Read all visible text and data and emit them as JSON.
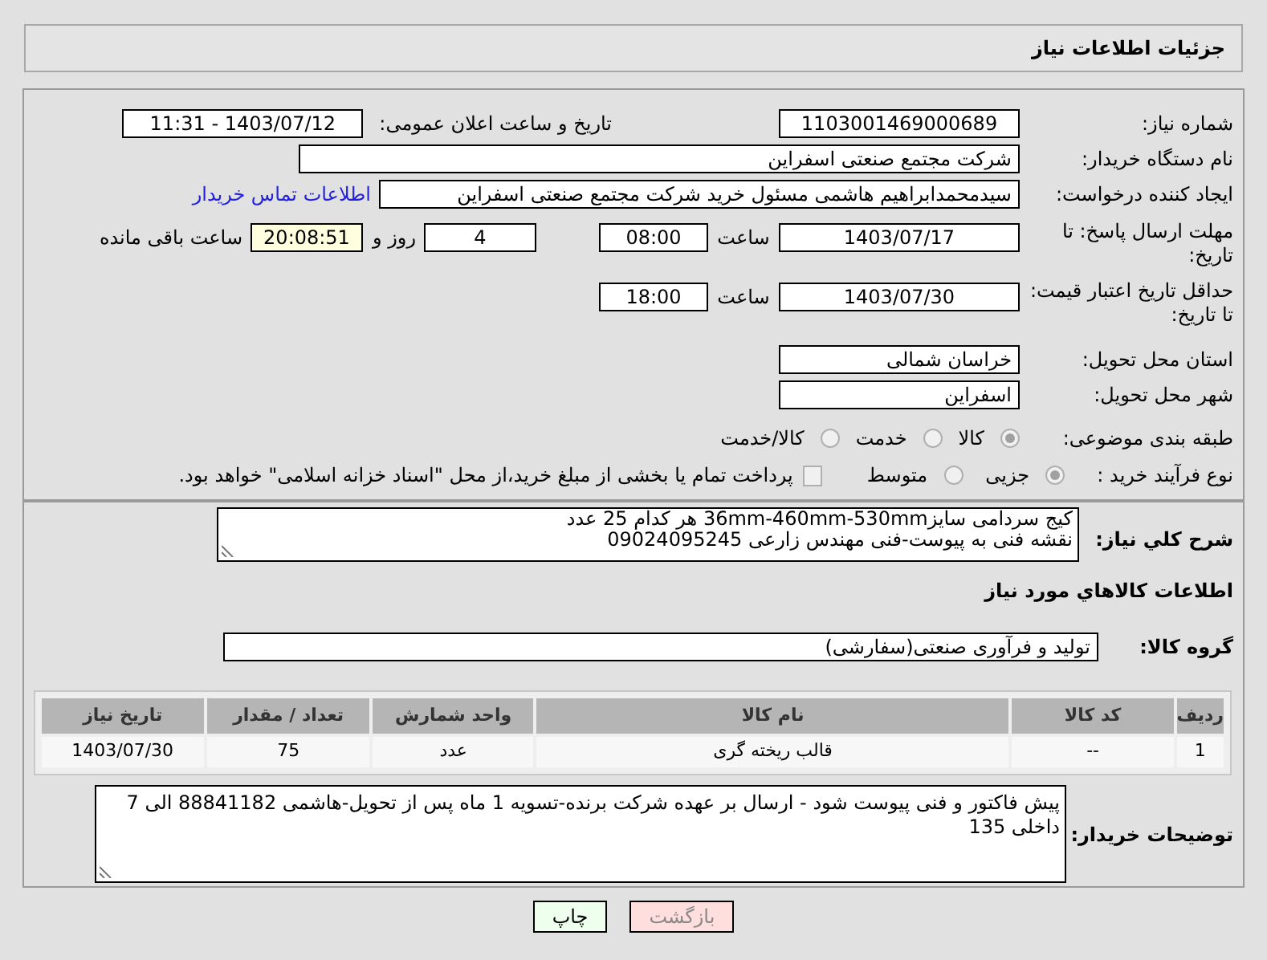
{
  "window": {
    "title": "جزئیات اطلاعات نیاز"
  },
  "need_number": {
    "label": "شماره نیاز:",
    "value": "1103001469000689"
  },
  "announce": {
    "label": "تاریخ و ساعت اعلان عمومی:",
    "value": "1403/07/12 - 11:31"
  },
  "buyer_org": {
    "label": "نام دستگاه خریدار:",
    "value": "شرکت مجتمع صنعتی اسفراین"
  },
  "requester": {
    "label": "ایجاد کننده درخواست:",
    "value": "سیدمحمدابراهیم هاشمی مسئول خرید شرکت مجتمع صنعتی اسفراین",
    "link": "اطلاعات تماس خریدار"
  },
  "reply_deadline": {
    "label": "مهلت ارسال پاسخ: تا تاریخ:",
    "date": "1403/07/17",
    "time_label": "ساعت",
    "time": "08:00",
    "days": "4",
    "days_label": "روز و",
    "remaining": "20:08:51",
    "remaining_label": "ساعت باقی مانده"
  },
  "price_validity": {
    "label": "حداقل تاریخ اعتبار قیمت: تا تاریخ:",
    "date": "1403/07/30",
    "time_label": "ساعت",
    "time": "18:00"
  },
  "province": {
    "label": "استان محل تحویل:",
    "value": "خراسان شمالی"
  },
  "city": {
    "label": "شهر محل تحویل:",
    "value": "اسفراین"
  },
  "category": {
    "label": "طبقه بندی موضوعی:",
    "options": [
      {
        "label": "کالا",
        "selected": true
      },
      {
        "label": "خدمت",
        "selected": false
      },
      {
        "label": "کالا/خدمت",
        "selected": false
      }
    ]
  },
  "process": {
    "label": "نوع فرآیند خرید :",
    "options": [
      {
        "label": "جزیی",
        "selected": true
      },
      {
        "label": "متوسط",
        "selected": false
      }
    ],
    "treasury": {
      "label": "پرداخت تمام یا بخشی از مبلغ خرید،از محل \"اسناد خزانه اسلامی\" خواهد بود.",
      "checked": false
    }
  },
  "description": {
    "label": "شرح كلي نياز:",
    "lines": [
      "کیج سردامی سایز36mm-460mm-530mm هر کدام 25 عدد",
      "نقشه فنی به پیوست-فنی مهندس زارعی 09024095245"
    ]
  },
  "items_heading": "اطلاعات كالاهاي مورد نياز",
  "goods_group": {
    "label": "گروه کالا:",
    "value": "تولید و فرآوری صنعتی(سفارشی)"
  },
  "table": {
    "columns": [
      "ردیف",
      "کد کالا",
      "نام کالا",
      "واحد شمارش",
      "تعداد / مقدار",
      "تاریخ نیاز"
    ],
    "rows": [
      [
        "1",
        "--",
        "قالب ریخته گری",
        "عدد",
        "75",
        "1403/07/30"
      ]
    ]
  },
  "buyer_notes": {
    "label": "توضیحات خریدار:",
    "value": "پیش فاکتور و فنی پیوست شود - ارسال بر عهده شرکت برنده-تسویه 1 ماه پس از تحویل-هاشمی 88841182 الی 7 داخلی 135"
  },
  "buttons": [
    {
      "label": "بازگشت",
      "kind": "back"
    },
    {
      "label": "چاپ",
      "kind": "print"
    }
  ]
}
